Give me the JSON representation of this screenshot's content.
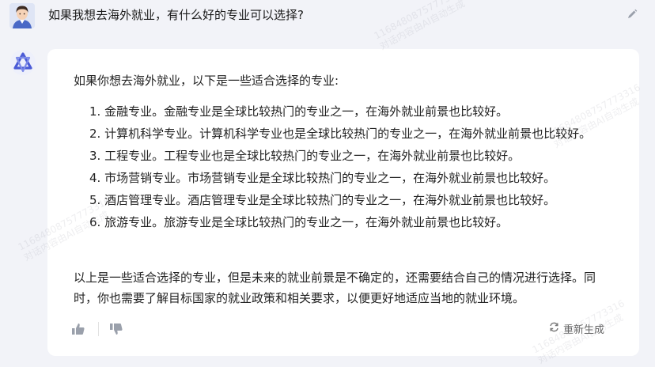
{
  "question": {
    "text": "如果我想去海外就业，有什么好的专业可以选择?"
  },
  "answer": {
    "intro": "如果你想去海外就业，以下是一些适合选择的专业:",
    "items": [
      "1. 金融专业。金融专业是全球比较热门的专业之一，在海外就业前景也比较好。",
      "2. 计算机科学专业。计算机科学专业也是全球比较热门的专业之一，在海外就业前景也比较好。",
      "3. 工程专业。工程专业也是全球比较热门的专业之一，在海外就业前景也比较好。",
      "4. 市场营销专业。市场营销专业是全球比较热门的专业之一，在海外就业前景也比较好。",
      "5. 酒店管理专业。酒店管理专业是全球比较热门的专业之一，在海外就业前景也比较好。",
      "6. 旅游专业。旅游专业是全球比较热门的专业之一，在海外就业前景也比较好。"
    ],
    "summary": "以上是一些适合选择的专业，但是未来的就业前景是不确定的，还需要结合自己的情况进行选择。同时，你也需要了解目标国家的就业政策和相关要求，以便更好地适应当地的就业环境。"
  },
  "actions": {
    "regenerate_label": "重新生成",
    "like_icon": "thumbs-up-icon",
    "dislike_icon": "thumbs-down-icon",
    "edit_icon": "pencil-icon",
    "regenerate_icon": "refresh-icon"
  },
  "watermark": {
    "id": "11684808757773316",
    "text": "对话内容由AI自动生成"
  },
  "colors": {
    "page_bg": "#f2f3f8",
    "card_bg": "#ffffff",
    "brand": "#4b5bd6",
    "text": "#222222",
    "muted": "#666666"
  }
}
